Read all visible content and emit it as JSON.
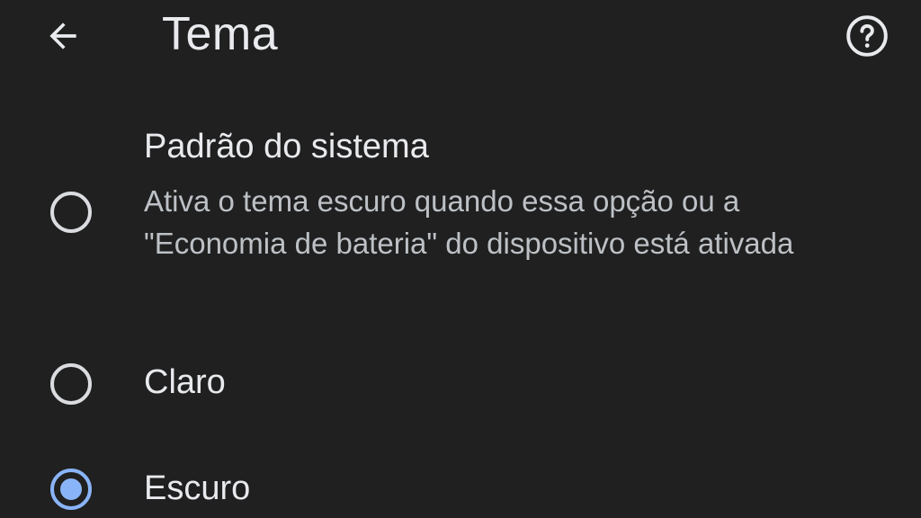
{
  "header": {
    "title": "Tema",
    "back_icon": "arrow-back-icon",
    "help_icon": "help-circle-icon"
  },
  "options": [
    {
      "label": "Padrão do sistema",
      "description": "Ativa o tema escuro quando essa opção ou a \"Economia de bateria\" do dispositivo está ativada",
      "selected": false
    },
    {
      "label": "Claro",
      "selected": false
    },
    {
      "label": "Escuro",
      "selected": true
    }
  ],
  "colors": {
    "background": "#202020",
    "text_primary": "#e8eaed",
    "text_secondary": "#bdc1c6",
    "radio_unselected": "#dadce0",
    "radio_selected": "#8ab4f8"
  }
}
